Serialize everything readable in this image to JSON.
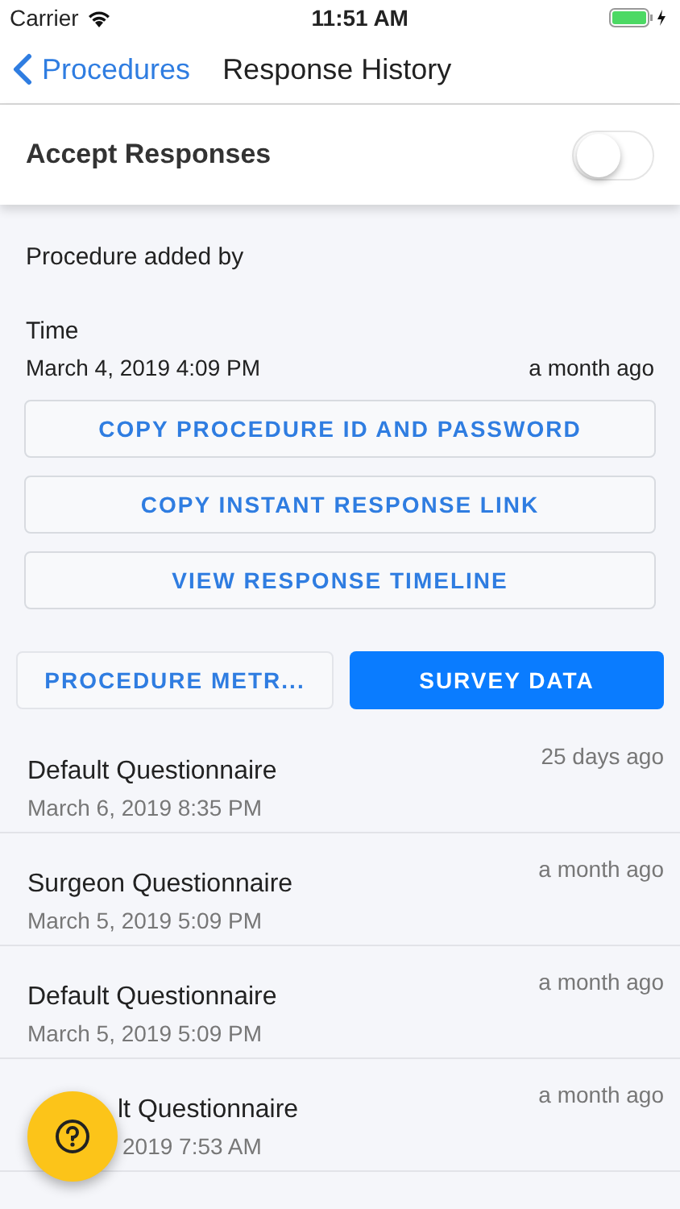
{
  "status_bar": {
    "carrier": "Carrier",
    "time": "11:51 AM"
  },
  "nav": {
    "back": "Procedures",
    "title": "Response History"
  },
  "accept_responses": {
    "label": "Accept Responses",
    "on": false
  },
  "procedure_added_by": {
    "label": "Procedure added by"
  },
  "time": {
    "label": "Time",
    "value": "March 4, 2019 4:09 PM",
    "relative": "a month ago"
  },
  "actions": [
    "COPY PROCEDURE ID AND PASSWORD",
    "COPY INSTANT RESPONSE LINK",
    "VIEW RESPONSE TIMELINE"
  ],
  "tabs": [
    {
      "label": "PROCEDURE METR...",
      "selected": false
    },
    {
      "label": "SURVEY DATA",
      "selected": true
    }
  ],
  "responses": [
    {
      "title": "Default Questionnaire",
      "date": "March 6, 2019 8:35 PM",
      "ago": "25 days ago"
    },
    {
      "title": "Surgeon Questionnaire",
      "date": "March 5, 2019 5:09 PM",
      "ago": "a month ago"
    },
    {
      "title": "Default Questionnaire",
      "date": "March 5, 2019 5:09 PM",
      "ago": "a month ago"
    },
    {
      "kind": "covered",
      "title": "lt Questionnaire",
      "date": "2019 7:53 AM",
      "ago": "a month ago"
    }
  ]
}
